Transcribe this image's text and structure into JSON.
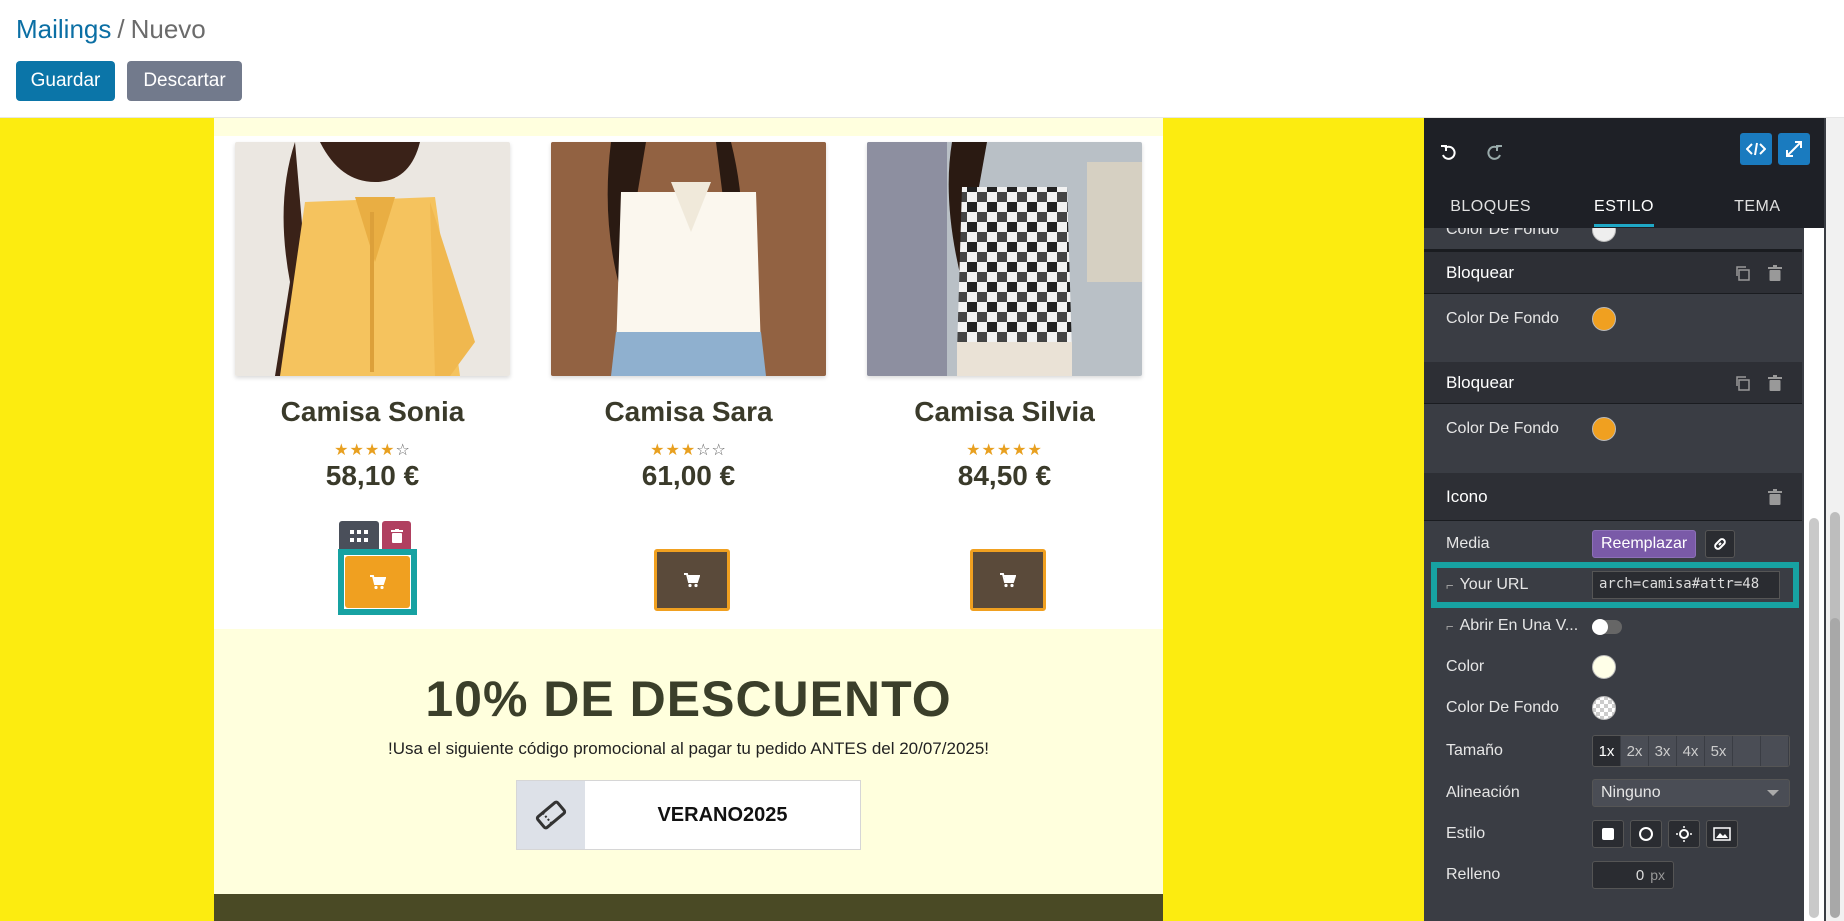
{
  "header": {
    "breadcrumb_root": "Mailings",
    "breadcrumb_sep": "/",
    "breadcrumb_current": "Nuevo",
    "save_label": "Guardar",
    "discard_label": "Descartar"
  },
  "products": [
    {
      "name": "Camisa Sonia",
      "rating": 4,
      "price": "58,10 €"
    },
    {
      "name": "Camisa Sara",
      "rating": 3,
      "price": "61,00 €"
    },
    {
      "name": "Camisa Silvia",
      "rating": 5,
      "price": "84,50 €"
    }
  ],
  "promo": {
    "headline": "10% DE DESCUENTO",
    "subtext": "!Usa el siguiente código promocional al pagar tu pedido ANTES del 20/07/2025!",
    "code": "VERANO2025"
  },
  "panel": {
    "tabs": [
      "BLOQUES",
      "ESTILO",
      "TEMA"
    ],
    "active_tab": "ESTILO",
    "partial_label": "Color De Fondo",
    "sections": [
      {
        "title": "Bloquear",
        "row_label": "Color De Fondo",
        "color": "#f0a020"
      },
      {
        "title": "Bloquear",
        "row_label": "Color De Fondo",
        "color": "#f0a020"
      }
    ],
    "icon_section": {
      "title": "Icono",
      "media_label": "Media",
      "replace_label": "Reemplazar",
      "url_label": "Your URL",
      "url_value": "arch=camisa#attr=48",
      "new_window_label": "Abrir En Una V...",
      "color_label": "Color",
      "bg_label": "Color De Fondo",
      "size_label": "Tamaño",
      "sizes": [
        "1x",
        "2x",
        "3x",
        "4x",
        "5x",
        "",
        ""
      ],
      "align_label": "Alineación",
      "align_value": "Ninguno",
      "style_label": "Estilo",
      "padding_label": "Relleno",
      "padding_value": "0",
      "padding_unit": "px"
    }
  },
  "colors": {
    "canvas_bg": "#fcec10",
    "accent_orange": "#f0a020",
    "selection_teal": "#17a2a2",
    "primary_blue": "#0b75a8"
  }
}
